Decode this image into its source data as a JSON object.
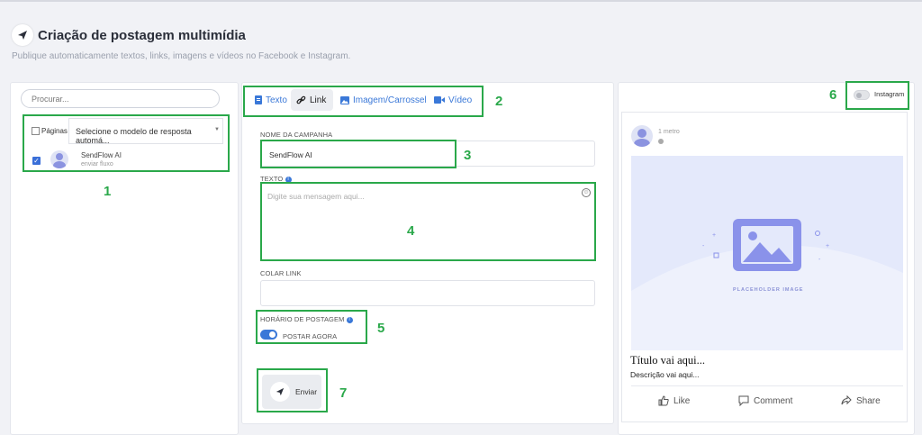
{
  "header": {
    "title": "Criação de postagem multimídia",
    "subtitle": "Publique automaticamente textos, links, imagens e vídeos no Facebook e Instagram."
  },
  "left": {
    "search_placeholder": "Procurar...",
    "pages_label": "Páginas",
    "template_select": "Selecione o modelo de resposta automá...",
    "account": {
      "name": "SendFlow AI",
      "subtitle": "enviar fluxo",
      "checked": true
    }
  },
  "tabs": [
    {
      "label": "Texto",
      "icon": "document-icon",
      "active": false
    },
    {
      "label": "Link",
      "icon": "link-icon",
      "active": true
    },
    {
      "label": "Imagem/Carrossel",
      "icon": "image-icon",
      "active": false
    },
    {
      "label": "Vídeo",
      "icon": "video-icon",
      "active": false
    }
  ],
  "form": {
    "campaign_label": "NOME DA CAMPANHA",
    "campaign_value": "SendFlow AI",
    "text_label": "TEXTO",
    "text_placeholder": "Digite sua mensagem aqui...",
    "link_label": "COLAR LINK",
    "link_value": "",
    "schedule_label": "HORÁRIO DE POSTAGEM",
    "post_now_label": "POSTAR AGORA",
    "post_now_enabled": true,
    "send_button": "Enviar"
  },
  "preview": {
    "instagram_label": "Instagram",
    "instagram_enabled": false,
    "time": "1 metro",
    "placeholder_text": "PLACEHOLDER IMAGE",
    "post_title": "Título vai aqui...",
    "post_description": "Descrição vai aqui...",
    "actions": [
      "Like",
      "Comment",
      "Share"
    ]
  },
  "annotations": [
    "1",
    "2",
    "3",
    "4",
    "5",
    "6",
    "7"
  ],
  "colors": {
    "annotation": "#2aa84a",
    "accent": "#3a78d8",
    "placeholder_bg": "#e4e9fb"
  }
}
